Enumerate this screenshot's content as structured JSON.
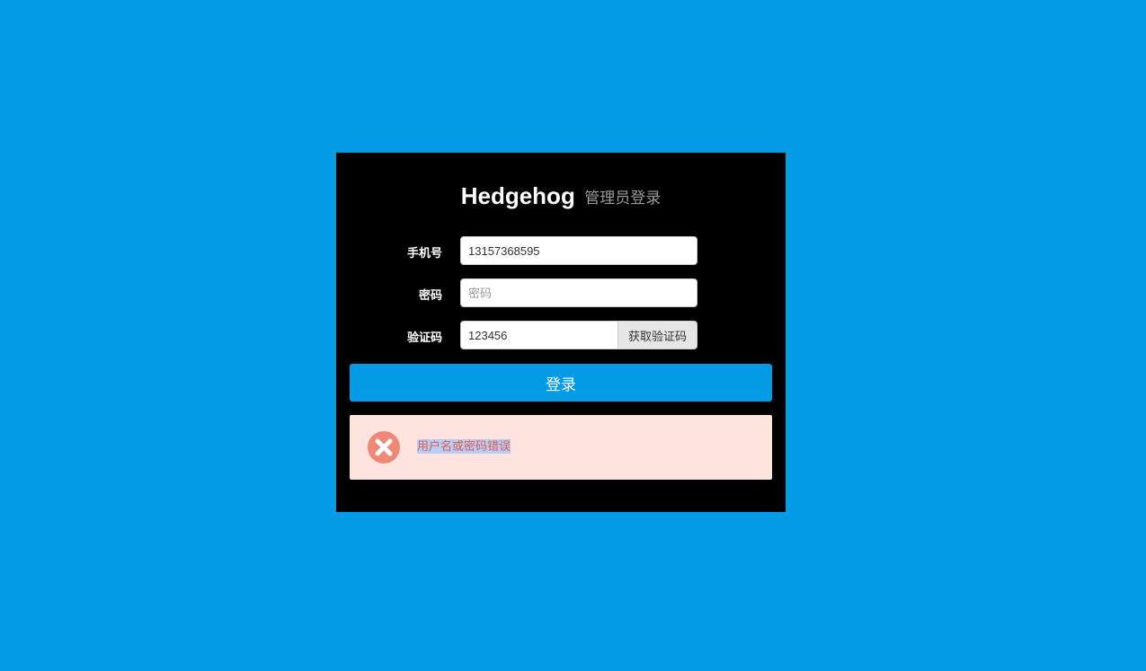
{
  "header": {
    "brand": "Hedgehog",
    "subtitle": "管理员登录"
  },
  "form": {
    "phone": {
      "label": "手机号",
      "value": "13157368595",
      "placeholder": ""
    },
    "password": {
      "label": "密码",
      "value": "",
      "placeholder": "密码"
    },
    "code": {
      "label": "验证码",
      "value": "123456",
      "placeholder": "",
      "button_label": "获取验证码"
    },
    "submit_label": "登录"
  },
  "alert": {
    "icon": "close-circle-icon",
    "message": "用户名或密码错误",
    "icon_color": "#f08876"
  },
  "colors": {
    "page_background": "#039be5",
    "panel_background": "#000000",
    "primary_button": "#039be5",
    "alert_background": "#ffe3df",
    "alert_text": "#e05a4f"
  }
}
